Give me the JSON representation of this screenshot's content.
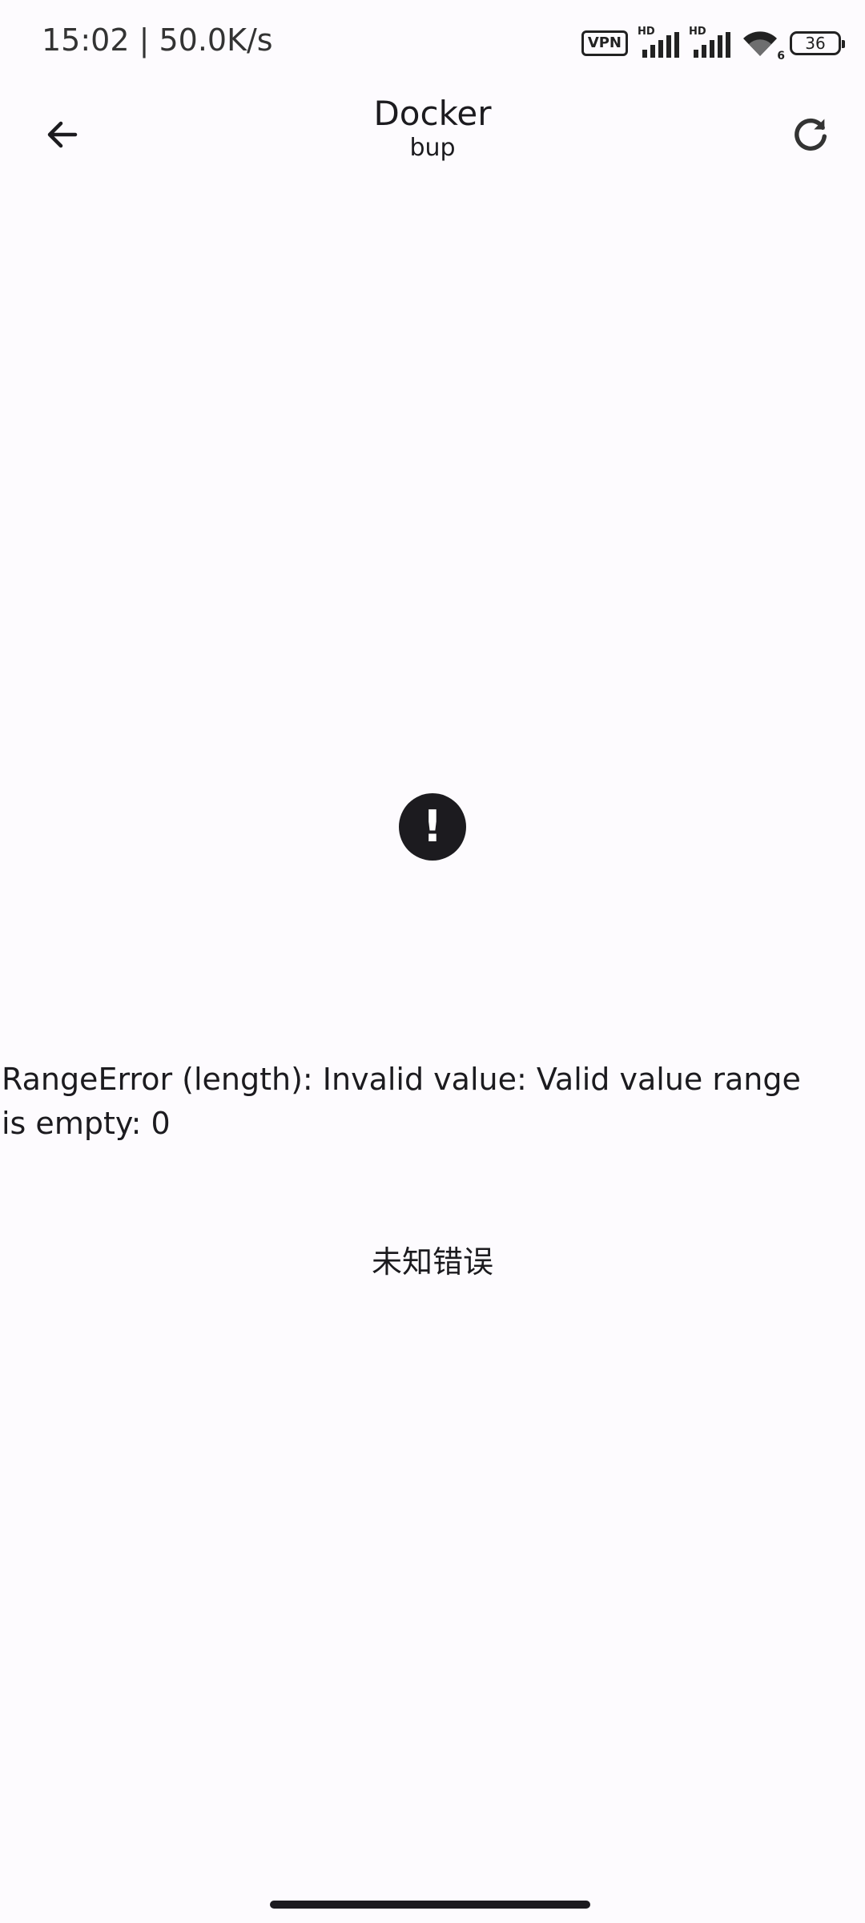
{
  "status_bar": {
    "time_speed": "15:02 | 50.0K/s",
    "vpn": "VPN",
    "hd1": "HD",
    "hd2": "HD",
    "wifi_label": "6",
    "battery": "36"
  },
  "app_bar": {
    "title": "Docker",
    "subtitle": "bup",
    "back_icon": "arrow-left-icon",
    "refresh_icon": "refresh-icon"
  },
  "content": {
    "error_icon": "exclamation-icon",
    "error_message": "RangeError (length): Invalid value: Valid value range is empty: 0",
    "unknown_error": "未知错误"
  },
  "colors": {
    "background": "#fdfbfe",
    "text": "#1c1b1f"
  }
}
